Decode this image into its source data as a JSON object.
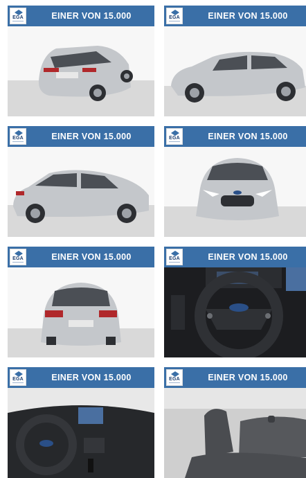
{
  "cards": [
    {
      "banner": "EINER VON 15.000",
      "logo": "EGA",
      "view": "rear-three-quarter"
    },
    {
      "banner": "EINER VON 15.000",
      "logo": "EGA",
      "view": "side-right"
    },
    {
      "banner": "EINER VON 15.000",
      "logo": "EGA",
      "view": "side-left"
    },
    {
      "banner": "EINER VON 15.000",
      "logo": "EGA",
      "view": "front"
    },
    {
      "banner": "EINER VON 15.000",
      "logo": "EGA",
      "view": "rear"
    },
    {
      "banner": "EINER VON 15.000",
      "logo": "EGA",
      "view": "steering-wheel"
    },
    {
      "banner": "EINER VON 15.000",
      "logo": "EGA",
      "view": "dashboard"
    },
    {
      "banner": "EINER VON 15.000",
      "logo": "EGA",
      "view": "rear-seats"
    }
  ],
  "colors": {
    "banner": "#3a6fa7",
    "car": "#c4c7cb",
    "background": "#ffffff"
  }
}
